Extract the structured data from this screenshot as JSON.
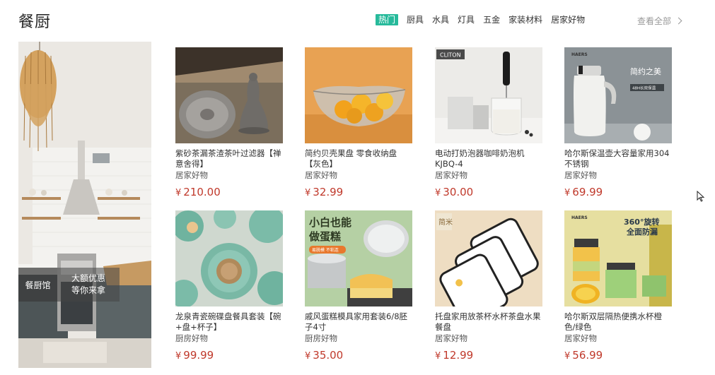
{
  "header": {
    "title": "餐厨",
    "tabs": [
      "热门",
      "厨具",
      "水具",
      "灯具",
      "五金",
      "家装材料",
      "居家好物"
    ],
    "active_tab": 0,
    "view_all": "查看全部"
  },
  "banner": {
    "tag_a": "餐厨馆",
    "tag_b_line1": "大额优惠",
    "tag_b_line2": "等你来拿"
  },
  "products": [
    {
      "name": "紫砂茶漏茶渣茶叶过滤器【禅意舍得】",
      "category": "居家好物",
      "price": "210.00",
      "currency": "¥"
    },
    {
      "name": "简约贝壳果盘 零食收纳盘【灰色】",
      "category": "居家好物",
      "price": "32.99",
      "currency": "¥"
    },
    {
      "name": "电动打奶泡器咖啡奶泡机 KJBQ-4",
      "category": "居家好物",
      "price": "30.00",
      "currency": "¥",
      "thumb_label": "CLITON"
    },
    {
      "name": "哈尔斯保温壶大容量家用304不锈钢",
      "category": "居家好物",
      "price": "69.99",
      "currency": "¥",
      "thumb_label": "简约之美",
      "thumb_badge": "48H长效保温",
      "brand": "HAERS"
    },
    {
      "name": "龙泉青瓷碗碟盘餐具套装【碗+盘+杯子】",
      "category": "厨房好物",
      "price": "99.99",
      "currency": "¥"
    },
    {
      "name": "戚风蛋糕模具家用套装6/8胚子4寸",
      "category": "厨房好物",
      "price": "35.00",
      "currency": "¥",
      "thumb_label": "小白也能 做蛋糕",
      "thumb_badge": "易脱模 不粘连"
    },
    {
      "name": "托盘家用放茶杯水杯茶盘水果餐盘",
      "category": "居家好物",
      "price": "12.99",
      "currency": "¥",
      "thumb_label": "简米"
    },
    {
      "name": "哈尔斯双层隔热便携水杯橙色/绿色",
      "category": "居家好物",
      "price": "56.99",
      "currency": "¥",
      "thumb_label": "360°旋转 全面防漏",
      "brand": "HAERS"
    }
  ],
  "colors": {
    "accent": "#27ba9b",
    "price": "#c0392b"
  }
}
